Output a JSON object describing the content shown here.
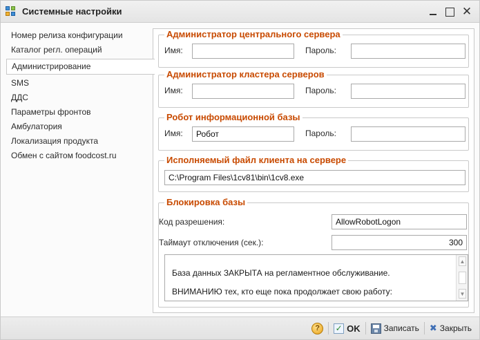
{
  "window": {
    "title": "Системные настройки",
    "minimize_glyph": "_",
    "maximize_glyph": "",
    "close_glyph": "✕"
  },
  "nav": {
    "items": [
      {
        "label": "Номер релиза конфигурации"
      },
      {
        "label": "Каталог регл. операций"
      },
      {
        "label": "Администрирование",
        "selected": true
      },
      {
        "label": "SMS"
      },
      {
        "label": "ДДС"
      },
      {
        "label": "Параметры фронтов"
      },
      {
        "label": "Амбулатория"
      },
      {
        "label": "Локализация продукта"
      },
      {
        "label": "Обмен с сайтом foodcost.ru"
      }
    ]
  },
  "admin_central": {
    "title": "Администратор центрального сервера",
    "name_label": "Имя:",
    "name_value": "",
    "password_label": "Пароль:",
    "password_value": ""
  },
  "admin_cluster": {
    "title": "Администратор кластера серверов",
    "name_label": "Имя:",
    "name_value": "",
    "password_label": "Пароль:",
    "password_value": ""
  },
  "robot": {
    "title": "Робот информационной базы",
    "name_label": "Имя:",
    "name_value": "Робот",
    "password_label": "Пароль:",
    "password_value": ""
  },
  "client_exe": {
    "title": "Исполняемый файл клиента на сервере",
    "path_value": "C:\\Program Files\\1cv81\\bin\\1cv8.exe"
  },
  "lock": {
    "title": "Блокировка базы",
    "code_label": "Код разрешения:",
    "code_value": "AllowRobotLogon",
    "timeout_label": "Таймаут отключения (сек.):",
    "timeout_value": "300",
    "message_line1": "База данных ЗАКРЫТА на регламентное обслуживание.",
    "message_line2": "ВНИМАНИЮ тех, кто еще пока продолжает свою работу:"
  },
  "bottom": {
    "help_glyph": "?",
    "ok_label": "OK",
    "save_label": "Записать",
    "close_label": "Закрыть"
  },
  "colors": {
    "group_title": "#c84a00",
    "panel_bg": "#ffffff",
    "window_bg": "#fbfbfb"
  }
}
